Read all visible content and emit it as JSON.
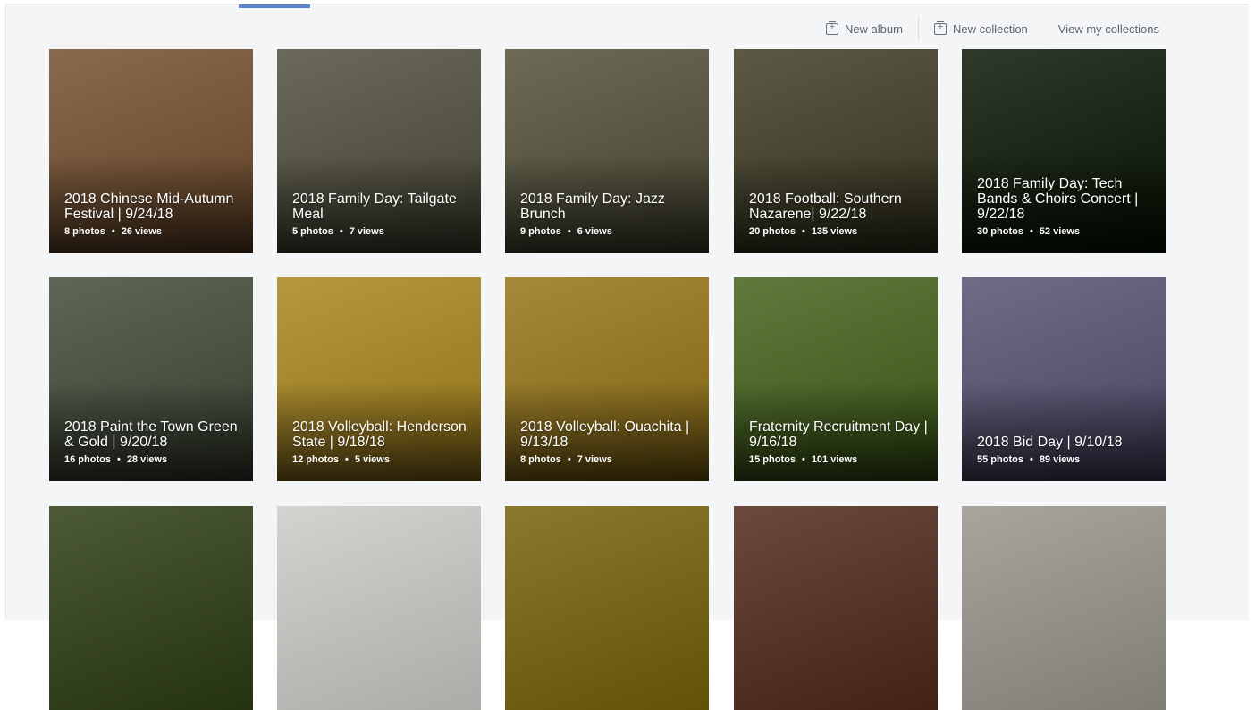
{
  "toolbar": {
    "new_album": "New album",
    "new_collection": "New collection",
    "view_collections": "View my collections"
  },
  "albums": [
    {
      "title": "2018 Chinese Mid-Autumn Festival | 9/24/18",
      "photos": "8 photos",
      "views": "26 views",
      "color": "#8a6a4e"
    },
    {
      "title": "2018 Family Day: Tailgate Meal",
      "photos": "5 photos",
      "views": "7 views",
      "color": "#6b6a5a"
    },
    {
      "title": "2018 Family Day: Jazz Brunch",
      "photos": "9 photos",
      "views": "6 views",
      "color": "#6d6b57"
    },
    {
      "title": "2018 Football: Southern Nazarene| 9/22/18",
      "photos": "20 photos",
      "views": "135 views",
      "color": "#5c5a45"
    },
    {
      "title": "2018 Family Day: Tech Bands & Choirs Concert | 9/22/18",
      "photos": "30 photos",
      "views": "52 views",
      "color": "#2f3a2a"
    },
    {
      "title": "2018 Paint the Town Green & Gold | 9/20/18",
      "photos": "16 photos",
      "views": "28 views",
      "color": "#5e6656"
    },
    {
      "title": "2018 Volleyball: Henderson State | 9/18/18",
      "photos": "12 photos",
      "views": "5 views",
      "color": "#b6983f"
    },
    {
      "title": "2018 Volleyball: Ouachita | 9/13/18",
      "photos": "8 photos",
      "views": "7 views",
      "color": "#a68a3a"
    },
    {
      "title": "Fraternity Recruitment Day | 9/16/18",
      "photos": "15 photos",
      "views": "101 views",
      "color": "#5f7a3c"
    },
    {
      "title": "2018 Bid Day | 9/10/18",
      "photos": "55 photos",
      "views": "89 views",
      "color": "#6f6c88"
    },
    {
      "title": "",
      "photos": "",
      "views": "",
      "color": "#4d5a38"
    },
    {
      "title": "",
      "photos": "",
      "views": "",
      "color": "#d3d3d0"
    },
    {
      "title": "",
      "photos": "",
      "views": "",
      "color": "#8a7a2e"
    },
    {
      "title": "",
      "photos": "",
      "views": "",
      "color": "#6b4a3e"
    },
    {
      "title": "",
      "photos": "",
      "views": "",
      "color": "#a8a59e"
    }
  ]
}
